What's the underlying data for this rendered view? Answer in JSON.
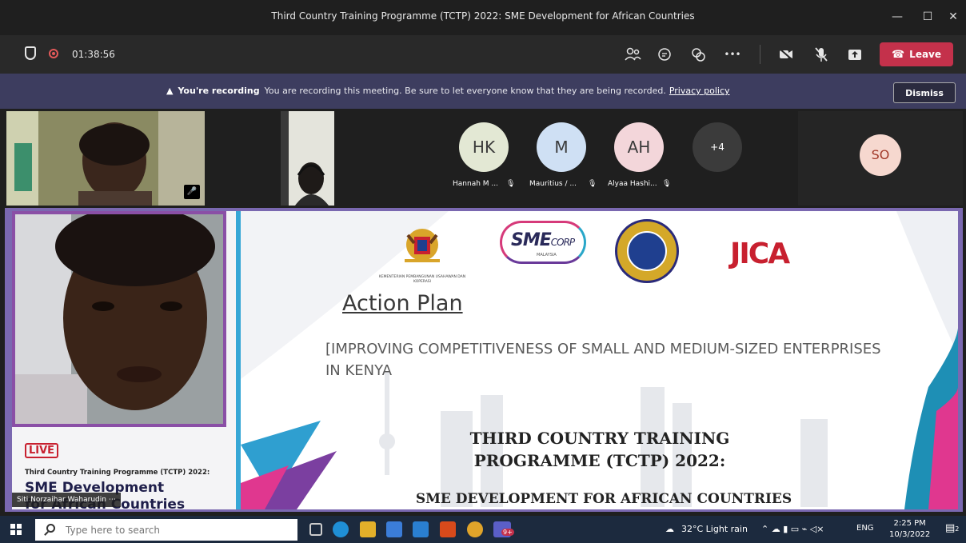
{
  "window": {
    "title": "Third Country Training Programme (TCTP) 2022: SME Development for African Countries",
    "minimize": "—",
    "maximize": "☐",
    "close": "✕"
  },
  "toolbar": {
    "timer": "01:38:56",
    "more": "•••",
    "leave_label": "Leave"
  },
  "recording_banner": {
    "heading": "You're recording",
    "message": "You are recording this meeting. Be sure to let everyone know that they are being recorded.",
    "link": "Privacy policy",
    "dismiss_label": "Dismiss"
  },
  "participants": [
    {
      "initials": "HK",
      "name": "Hannah M ...",
      "color": "#e3e8d4"
    },
    {
      "initials": "M",
      "name": "Mauritius / ...",
      "color": "#cfe0f4"
    },
    {
      "initials": "AH",
      "name": "Alyaa Hashi...",
      "color": "#f3d6da"
    }
  ],
  "overflow_count": "+4",
  "spotlight_participant": {
    "initials": "SO",
    "color": "#f6d8cf"
  },
  "slide": {
    "kementerian": "KEMENTERIAN PEMBANGUNAN USAHAWAN DAN KOPERASI",
    "sme_logo_main": "SME",
    "sme_logo_corp": "CORP",
    "sme_logo_sub": "MALAYSIA",
    "jica_logo": "JICA",
    "heading": "Action Plan",
    "subtitle": "[IMPROVING COMPETITIVENESS OF SMALL AND MEDIUM-SIZED ENTERPRISES IN KENYA",
    "programme_title_line1": "THIRD COUNTRY TRAINING",
    "programme_title_line2": "PROGRAMME (TCTP) 2022:",
    "programme_subtitle": "SME DEVELOPMENT FOR AFRICAN COUNTRIES",
    "left_panel": {
      "live_badge": "LIVE",
      "line1": "Third Country Training Programme (TCTP) 2022:",
      "line2": "SME Development",
      "line3": "for African Countries"
    },
    "presenter_name": "Siti Norzaihar Waharudin"
  },
  "taskbar": {
    "search_placeholder": "Type here to search",
    "weather": "32°C  Light rain",
    "language": "ENG",
    "time": "2:25 PM",
    "date": "10/3/2022",
    "teams_badge": "9+",
    "notification_count": "2"
  }
}
